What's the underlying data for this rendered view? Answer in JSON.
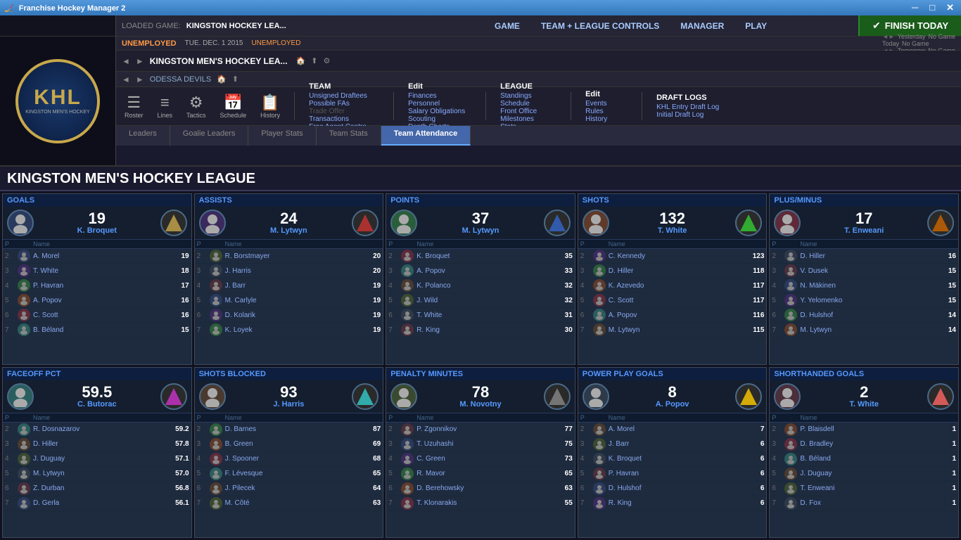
{
  "titlebar": {
    "title": "Franchise Hockey Manager 2",
    "min": "─",
    "max": "□",
    "close": "✕"
  },
  "header": {
    "loaded_label": "LOADED GAME:",
    "loaded_name": "KINGSTON HOCKEY LEA...",
    "game_label": "GAME",
    "team_league_label": "TEAM + LEAGUE CONTROLS",
    "manager_label": "MANAGER",
    "play_label": "PLAY",
    "finish_label": "FINISH TODAY",
    "status": "UNEMPLOYED",
    "date": "TUE. DEC. 1 2015",
    "status2": "UNEMPLOYED",
    "yesterday_label": "Yesterday",
    "today_label": "Today",
    "tomorrow_label": "Tomorrow",
    "yesterday_val": "No Game",
    "today_val": "No Game",
    "tomorrow_val": "No Game",
    "team_name": "KINGSTON MEN'S HOCKEY LEA...",
    "sub_team": "ODESSA DEVILS"
  },
  "toolbar": {
    "roster": "Roster",
    "lines": "Lines",
    "tactics": "Tactics",
    "schedule": "Schedule",
    "history": "History"
  },
  "team_menu": {
    "title": "TEAM",
    "items": [
      "Unsigned Draftees",
      "Possible FAs",
      "Trade Offer",
      "Transactions",
      "Free Agent Centre"
    ]
  },
  "league_menu": {
    "title": "LEAGUE",
    "items": [
      "Standings",
      "Schedule",
      "Front Office",
      "Milestones",
      "Stats"
    ]
  },
  "edit_menu": {
    "title": "Edit",
    "items": [
      "Finances",
      "Personnel",
      "Salary Obligations",
      "Scouting",
      "Depth Charts"
    ]
  },
  "edit2_menu": {
    "title": "Edit",
    "items": [
      "Events",
      "Rules",
      "History"
    ]
  },
  "draft_logs": {
    "title": "DRAFT LOGS",
    "items": [
      "KHL Entry Draft Log",
      "Initial Draft Log"
    ]
  },
  "tabs": {
    "leaders": "Leaders",
    "goalie_leaders": "Goalie Leaders",
    "player_stats": "Player Stats",
    "team_stats": "Team Stats",
    "team_attendance": "Team Attendance"
  },
  "league_title": "KINGSTON MEN'S HOCKEY LEAGUE",
  "cards": [
    {
      "id": "goals",
      "title": "GOALS",
      "leader_score": "19",
      "leader_name": "K. Broquet",
      "rows": [
        {
          "rank": "2",
          "name": "A. Morel",
          "val": "19"
        },
        {
          "rank": "3",
          "name": "T. White",
          "val": "18"
        },
        {
          "rank": "4",
          "name": "P. Havran",
          "val": "17"
        },
        {
          "rank": "5",
          "name": "A. Popov",
          "val": "16"
        },
        {
          "rank": "6",
          "name": "C. Scott",
          "val": "16"
        },
        {
          "rank": "7",
          "name": "B. Béland",
          "val": "15"
        }
      ]
    },
    {
      "id": "assists",
      "title": "ASSISTS",
      "leader_score": "24",
      "leader_name": "M. Lytwyn",
      "rows": [
        {
          "rank": "2",
          "name": "R. Borstmayer",
          "val": "20"
        },
        {
          "rank": "3",
          "name": "J. Harris",
          "val": "20"
        },
        {
          "rank": "4",
          "name": "J. Barr",
          "val": "19"
        },
        {
          "rank": "5",
          "name": "M. Carlyle",
          "val": "19"
        },
        {
          "rank": "6",
          "name": "D. Kolarik",
          "val": "19"
        },
        {
          "rank": "7",
          "name": "K. Loyek",
          "val": "19"
        }
      ]
    },
    {
      "id": "points",
      "title": "POINTS",
      "leader_score": "37",
      "leader_name": "M. Lytwyn",
      "rows": [
        {
          "rank": "2",
          "name": "K. Broquet",
          "val": "35"
        },
        {
          "rank": "3",
          "name": "A. Popov",
          "val": "33"
        },
        {
          "rank": "4",
          "name": "K. Polanco",
          "val": "32"
        },
        {
          "rank": "5",
          "name": "J. Wild",
          "val": "32"
        },
        {
          "rank": "6",
          "name": "T. White",
          "val": "31"
        },
        {
          "rank": "7",
          "name": "R. King",
          "val": "30"
        }
      ]
    },
    {
      "id": "shots",
      "title": "SHOTS",
      "leader_score": "132",
      "leader_name": "T. White",
      "rows": [
        {
          "rank": "2",
          "name": "C. Kennedy",
          "val": "123"
        },
        {
          "rank": "3",
          "name": "D. Hiller",
          "val": "118"
        },
        {
          "rank": "4",
          "name": "K. Azevedo",
          "val": "117"
        },
        {
          "rank": "5",
          "name": "C. Scott",
          "val": "117"
        },
        {
          "rank": "6",
          "name": "A. Popov",
          "val": "116"
        },
        {
          "rank": "7",
          "name": "M. Lytwyn",
          "val": "115"
        }
      ]
    },
    {
      "id": "plus_minus",
      "title": "PLUS/MINUS",
      "leader_score": "17",
      "leader_name": "T. Enweani",
      "rows": [
        {
          "rank": "2",
          "name": "D. Hiller",
          "val": "16"
        },
        {
          "rank": "3",
          "name": "V. Dusek",
          "val": "15"
        },
        {
          "rank": "4",
          "name": "N. Mäkinen",
          "val": "15"
        },
        {
          "rank": "5",
          "name": "Y. Yelomenko",
          "val": "15"
        },
        {
          "rank": "6",
          "name": "D. Hulshof",
          "val": "14"
        },
        {
          "rank": "7",
          "name": "M. Lytwyn",
          "val": "14"
        }
      ]
    },
    {
      "id": "faceoff_pct",
      "title": "FACEOFF PCT",
      "leader_score": "59.5",
      "leader_name": "C. Butorac",
      "rows": [
        {
          "rank": "2",
          "name": "R. Dosnazarov",
          "val": "59.2"
        },
        {
          "rank": "3",
          "name": "D. Hiller",
          "val": "57.8"
        },
        {
          "rank": "4",
          "name": "J. Duguay",
          "val": "57.1"
        },
        {
          "rank": "5",
          "name": "M. Lytwyn",
          "val": "57.0"
        },
        {
          "rank": "6",
          "name": "Z. Durban",
          "val": "56.8"
        },
        {
          "rank": "7",
          "name": "D. Gerla",
          "val": "56.1"
        }
      ]
    },
    {
      "id": "shots_blocked",
      "title": "SHOTS BLOCKED",
      "leader_score": "93",
      "leader_name": "J. Harris",
      "rows": [
        {
          "rank": "2",
          "name": "D. Barnes",
          "val": "87"
        },
        {
          "rank": "3",
          "name": "B. Green",
          "val": "69"
        },
        {
          "rank": "4",
          "name": "J. Spooner",
          "val": "68"
        },
        {
          "rank": "5",
          "name": "F. Lévesque",
          "val": "65"
        },
        {
          "rank": "6",
          "name": "J. Pilecek",
          "val": "64"
        },
        {
          "rank": "7",
          "name": "M. Côté",
          "val": "63"
        }
      ]
    },
    {
      "id": "penalty_minutes",
      "title": "PENALTY MINUTES",
      "leader_score": "78",
      "leader_name": "M. Novotny",
      "rows": [
        {
          "rank": "2",
          "name": "P. Zgonnikov",
          "val": "77"
        },
        {
          "rank": "3",
          "name": "T. Uzuhashi",
          "val": "75"
        },
        {
          "rank": "4",
          "name": "C. Green",
          "val": "73"
        },
        {
          "rank": "5",
          "name": "R. Mavor",
          "val": "65"
        },
        {
          "rank": "6",
          "name": "D. Berehowsky",
          "val": "63"
        },
        {
          "rank": "7",
          "name": "T. Klonarakis",
          "val": "55"
        }
      ]
    },
    {
      "id": "power_play_goals",
      "title": "POWER PLAY GOALS",
      "leader_score": "8",
      "leader_name": "A. Popov",
      "rows": [
        {
          "rank": "2",
          "name": "A. Morel",
          "val": "7"
        },
        {
          "rank": "3",
          "name": "J. Barr",
          "val": "6"
        },
        {
          "rank": "4",
          "name": "K. Broquet",
          "val": "6"
        },
        {
          "rank": "5",
          "name": "P. Havran",
          "val": "6"
        },
        {
          "rank": "6",
          "name": "D. Hulshof",
          "val": "6"
        },
        {
          "rank": "7",
          "name": "R. King",
          "val": "6"
        }
      ]
    },
    {
      "id": "shorthanded_goals",
      "title": "SHORTHANDED GOALS",
      "leader_score": "2",
      "leader_name": "T. White",
      "rows": [
        {
          "rank": "2",
          "name": "P. Blaisdell",
          "val": "1"
        },
        {
          "rank": "3",
          "name": "D. Bradley",
          "val": "1"
        },
        {
          "rank": "4",
          "name": "B. Béland",
          "val": "1"
        },
        {
          "rank": "5",
          "name": "J. Duguay",
          "val": "1"
        },
        {
          "rank": "6",
          "name": "T. Enweani",
          "val": "1"
        },
        {
          "rank": "7",
          "name": "D. Fox",
          "val": "1"
        }
      ]
    }
  ],
  "col_headers": {
    "p": "P",
    "name": "Name",
    "val": ""
  }
}
